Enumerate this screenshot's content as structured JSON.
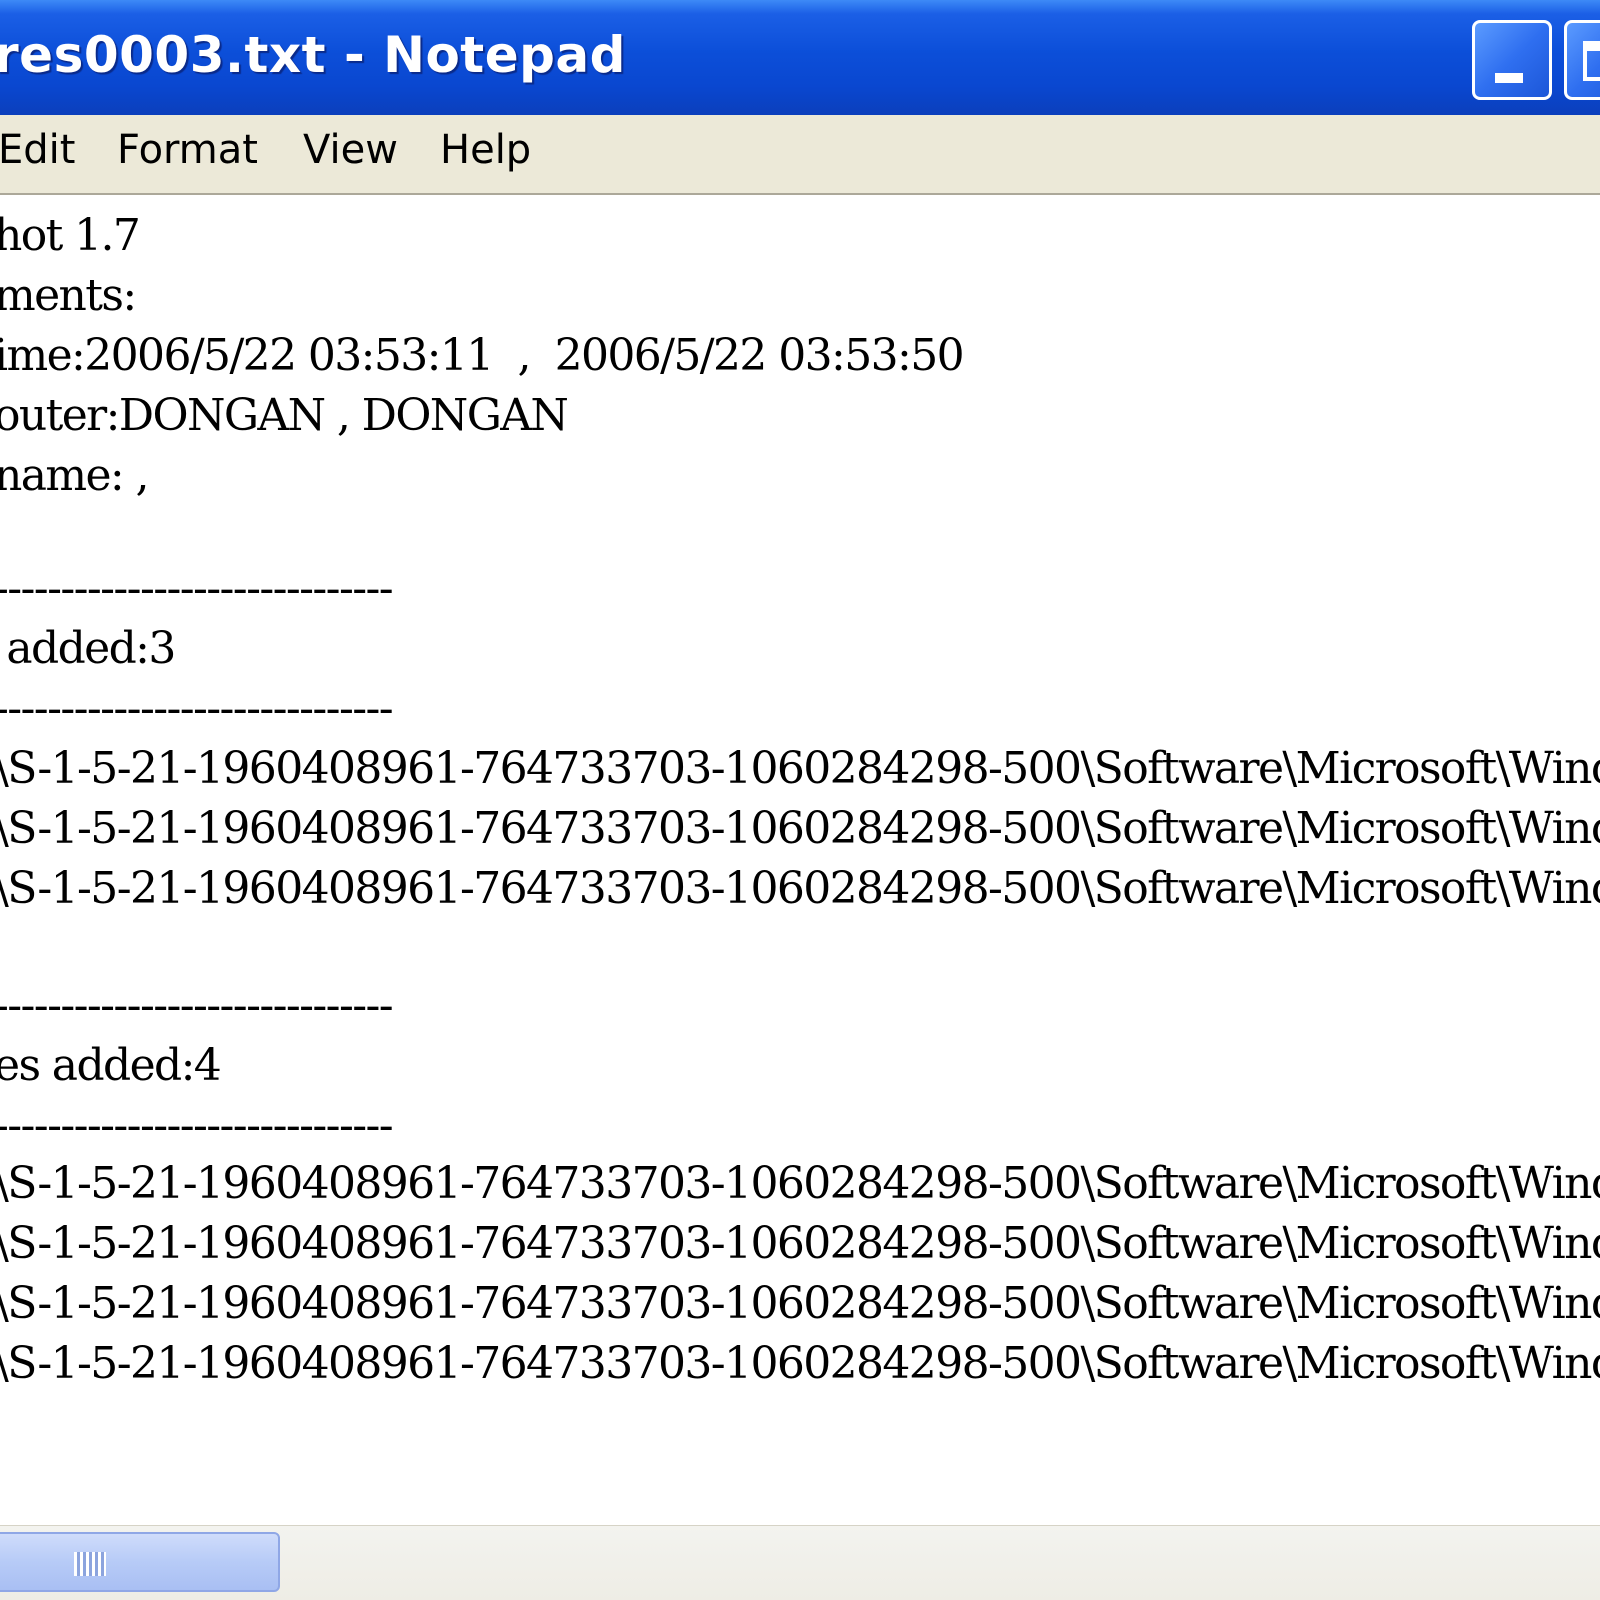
{
  "window": {
    "title": "res0003.txt - Notepad"
  },
  "menu": [
    "Edit",
    "Format",
    "View",
    "Help"
  ],
  "content": {
    "lines": [
      "hot 1.7",
      "ments:",
      "ime:2006/5/22 03:53:11  ,  2006/5/22 03:53:50",
      "outer:DONGAN , DONGAN",
      "name: ,",
      "",
      "------------------------------",
      " added:3",
      "------------------------------",
      "\\S-1-5-21-1960408961-764733703-1060284298-500\\Software\\Microsoft\\Windo",
      "\\S-1-5-21-1960408961-764733703-1060284298-500\\Software\\Microsoft\\Windo",
      "\\S-1-5-21-1960408961-764733703-1060284298-500\\Software\\Microsoft\\Windo",
      "",
      "------------------------------",
      "es added:4",
      "------------------------------",
      "\\S-1-5-21-1960408961-764733703-1060284298-500\\Software\\Microsoft\\Windo",
      "\\S-1-5-21-1960408961-764733703-1060284298-500\\Software\\Microsoft\\Windo",
      "\\S-1-5-21-1960408961-764733703-1060284298-500\\Software\\Microsoft\\Windo",
      "\\S-1-5-21-1960408961-764733703-1060284298-500\\Software\\Microsoft\\Windo"
    ]
  },
  "colors": {
    "titlebar": "#0a47d0",
    "menubar": "#ece9d8",
    "editor_bg": "#ffffff",
    "scroll_thumb": "#b7cbf7"
  },
  "icons": {
    "minimize": "minimize-icon",
    "maximize": "maximize-icon",
    "scroll_grip": "scroll-grip-icon"
  }
}
